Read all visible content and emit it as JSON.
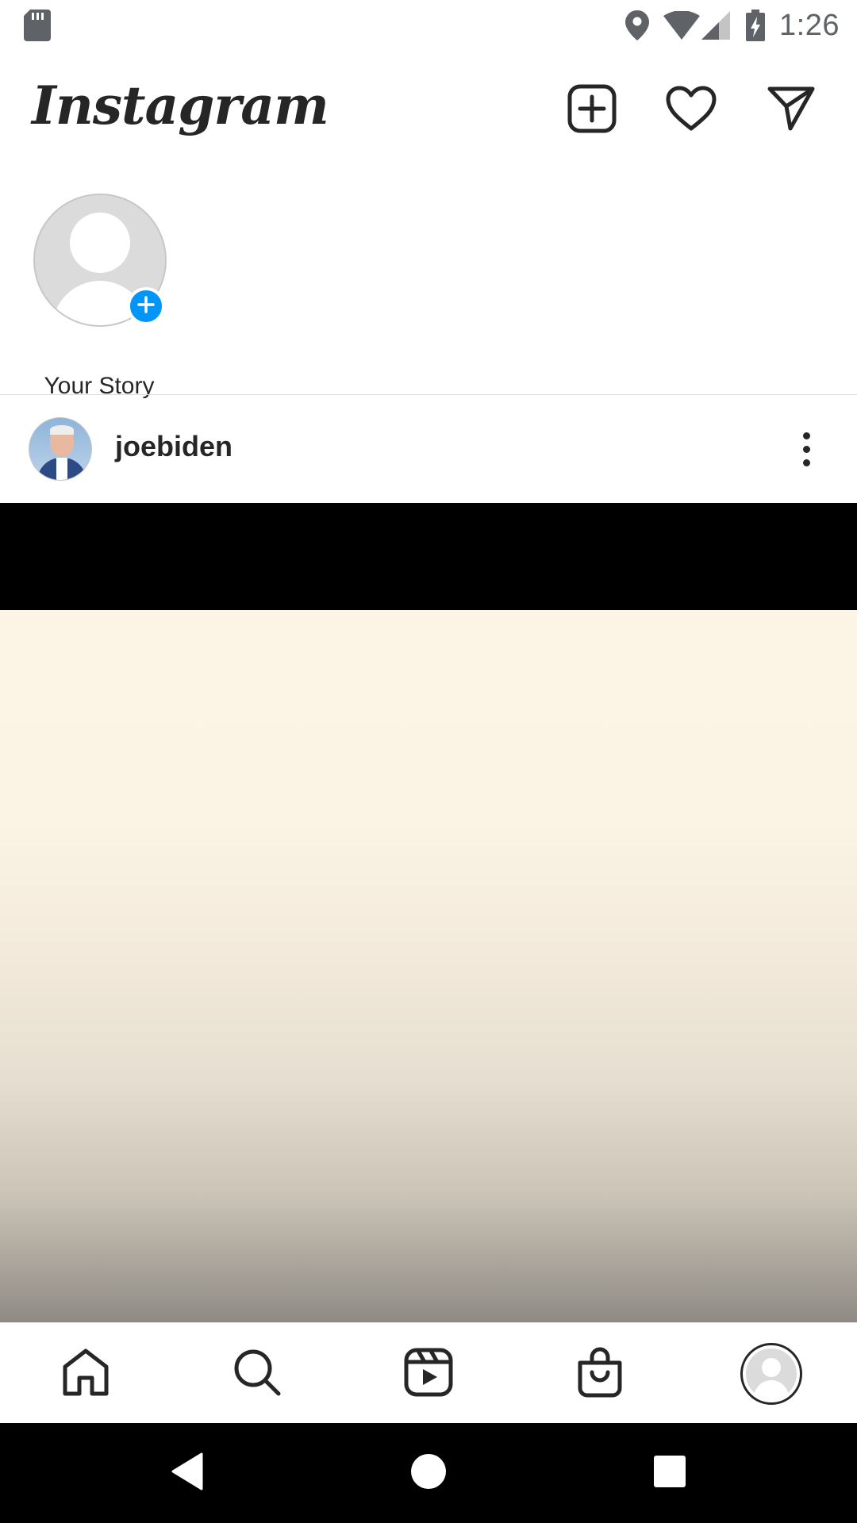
{
  "status_bar": {
    "time": "1:26",
    "icons": [
      "sd-card-icon",
      "location-icon",
      "wifi-icon",
      "cell-signal-icon",
      "battery-charging-icon"
    ]
  },
  "header": {
    "logo": "Instagram",
    "actions": [
      "new-post-icon",
      "heart-icon",
      "direct-message-icon"
    ]
  },
  "stories": {
    "items": [
      {
        "label": "Your Story",
        "add_badge": "plus-icon"
      }
    ]
  },
  "post": {
    "username": "joebiden",
    "more_icon": "more-vertical-icon"
  },
  "bottom_nav": {
    "items": [
      "home-icon",
      "search-icon",
      "reels-icon",
      "shop-icon",
      "profile-icon"
    ]
  },
  "system_nav": {
    "items": [
      "back-icon",
      "home-circle-icon",
      "recents-icon"
    ]
  },
  "colors": {
    "accent": "#0095f6",
    "text": "#262626",
    "divider": "#dbdbdb",
    "status_grey": "#5f6368"
  }
}
